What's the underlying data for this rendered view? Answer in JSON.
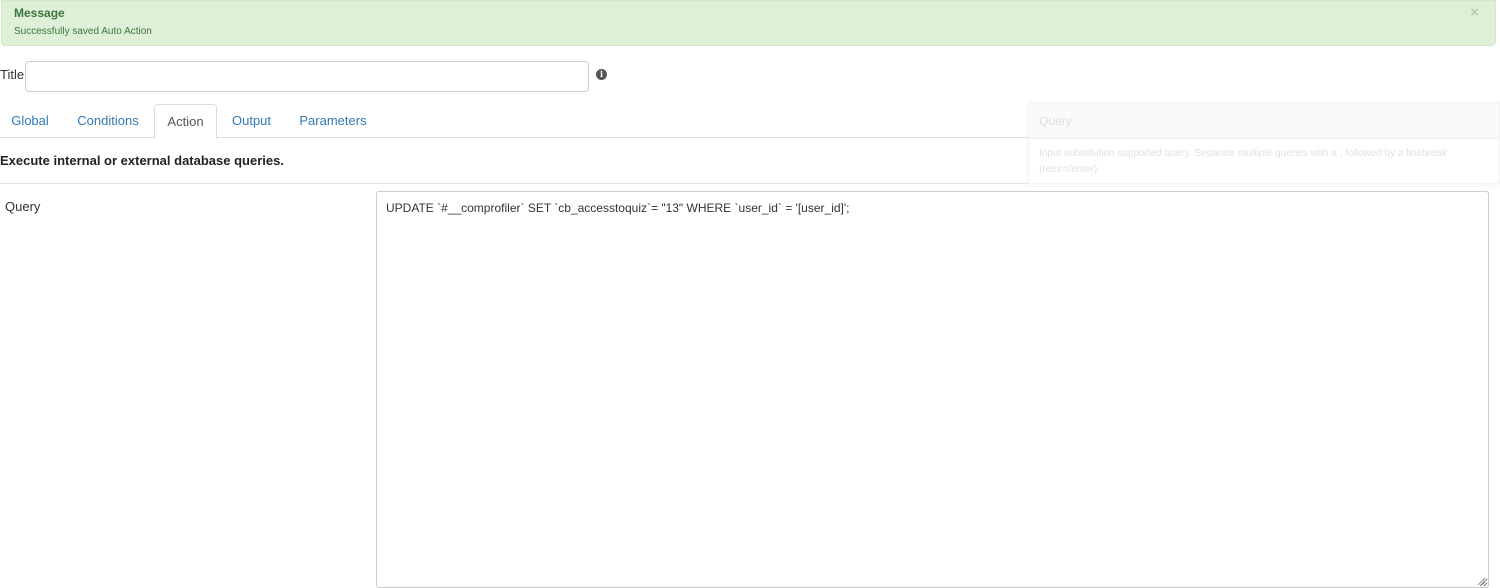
{
  "alert": {
    "title": "Message",
    "text": "Successfully saved Auto Action",
    "close_symbol": "×",
    "background_color": "#dff0d8",
    "text_color": "#3c763d"
  },
  "title_field": {
    "label": "Title",
    "value": "",
    "placeholder": "",
    "info_icon": "info-circle-icon",
    "info_symbol": "i"
  },
  "tabs": [
    {
      "label": "Global",
      "active": false
    },
    {
      "label": "Conditions",
      "active": false
    },
    {
      "label": "Action",
      "active": true
    },
    {
      "label": "Output",
      "active": false
    },
    {
      "label": "Parameters",
      "active": false
    }
  ],
  "action": {
    "description": "Execute internal or external database queries.",
    "query_label": "Query",
    "query_value": "UPDATE `#__comprofiler` SET `cb_accesstoquiz`= \"13\" WHERE `user_id` = '[user_id]';"
  },
  "popover": {
    "title": "Query",
    "content_line1": "Input substitution supported query. Separate multiple queries with a ; followed by a linebreak",
    "content_line2": "(return/enter)."
  },
  "colors": {
    "link": "#337ab7",
    "active_tab_text": "#555555",
    "border": "#dddddd"
  }
}
